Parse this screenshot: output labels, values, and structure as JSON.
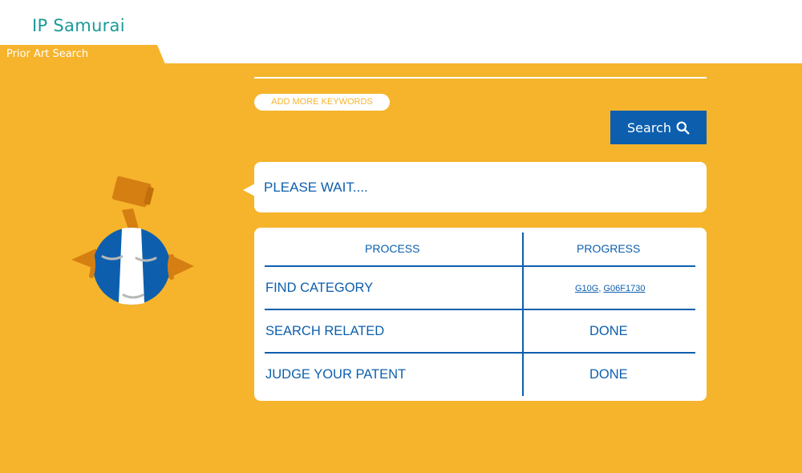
{
  "header": {
    "brand": "IP Samurai",
    "tab_label": "Prior Art Search"
  },
  "search": {
    "add_keywords_label": "ADD MORE KEYWORDS",
    "search_button_label": "Search"
  },
  "status": {
    "message": "PLEASE WAIT...."
  },
  "progress_table": {
    "headers": [
      "PROCESS",
      "PROGRESS"
    ],
    "rows": [
      {
        "process": "FIND CATEGORY",
        "progress_links": [
          "G10G",
          "G06F1730"
        ],
        "separator": ", "
      },
      {
        "process": "SEARCH RELATED",
        "progress": "DONE"
      },
      {
        "process": "JUDGE YOUR PATENT",
        "progress": "DONE"
      }
    ]
  },
  "colors": {
    "accent": "#f6b42c",
    "primary": "#0d5fae",
    "brand": "#1a9a96"
  },
  "icons": {
    "search": "search-icon",
    "mascot": "samurai-mascot-icon"
  }
}
